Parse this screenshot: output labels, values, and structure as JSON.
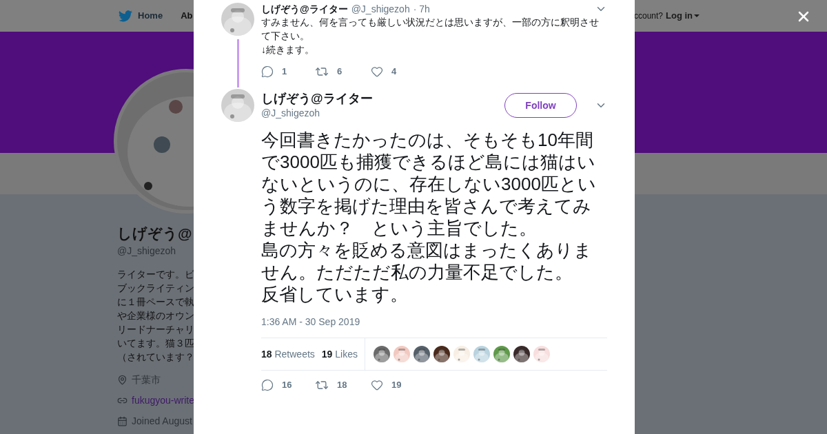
{
  "nav": {
    "items": [
      "Home",
      "Ab"
    ],
    "account_prompt": "ccount?",
    "login": "Log in"
  },
  "profile": {
    "name": "しげぞう@",
    "handle": "@J_shigezoh",
    "bio": [
      "ライターです。ビ",
      "ブックライティン",
      "に１冊ペースで執",
      "や企業様のオウン",
      "リードナーチャリ",
      "いてます。猫３匹",
      "（されています？"
    ],
    "location": "千葉市",
    "link": "fukugyou-write",
    "joined": "Joined August"
  },
  "previous_tweet": {
    "name": "しげぞう@ライター",
    "handle": "@J_shigezoh",
    "time": "· 7h",
    "paragraphs": [
      "すみません、何を言っても厳しい状況だとは思いますが、一部の方に釈明させて下さい。",
      "↓続きます。"
    ],
    "replies": "1",
    "retweets": "6",
    "likes": "4"
  },
  "main_tweet": {
    "name": "しげぞう@ライター",
    "handle": "@J_shigezoh",
    "follow": "Follow",
    "paragraphs": [
      "今回書きたかったのは、そもそも10年間で3000匹も捕獲できるほど島には猫はいないというのに、存在しない3000匹という数字を掲げた理由を皆さんで考えてみませんか？　という主旨でした。",
      "島の方々を貶める意図はまったくありません。ただただ私の力量不足でした。",
      "反省しています。"
    ],
    "timestamp": "1:36 AM - 30 Sep 2019",
    "retweet_count": "18",
    "retweet_label": "Retweets",
    "like_count": "19",
    "like_label": "Likes",
    "likers": [
      {
        "color": "#6b6b6b"
      },
      {
        "color": "#f2c9c0"
      },
      {
        "color": "#55606a"
      },
      {
        "color": "#4a2a1c"
      },
      {
        "color": "#f7eee4"
      },
      {
        "color": "#b9d3df"
      },
      {
        "color": "#5f9a4a"
      },
      {
        "color": "#3a2a2a"
      },
      {
        "color": "#f8dede"
      }
    ],
    "replies": "16",
    "retweets": "18",
    "likes": "19"
  }
}
